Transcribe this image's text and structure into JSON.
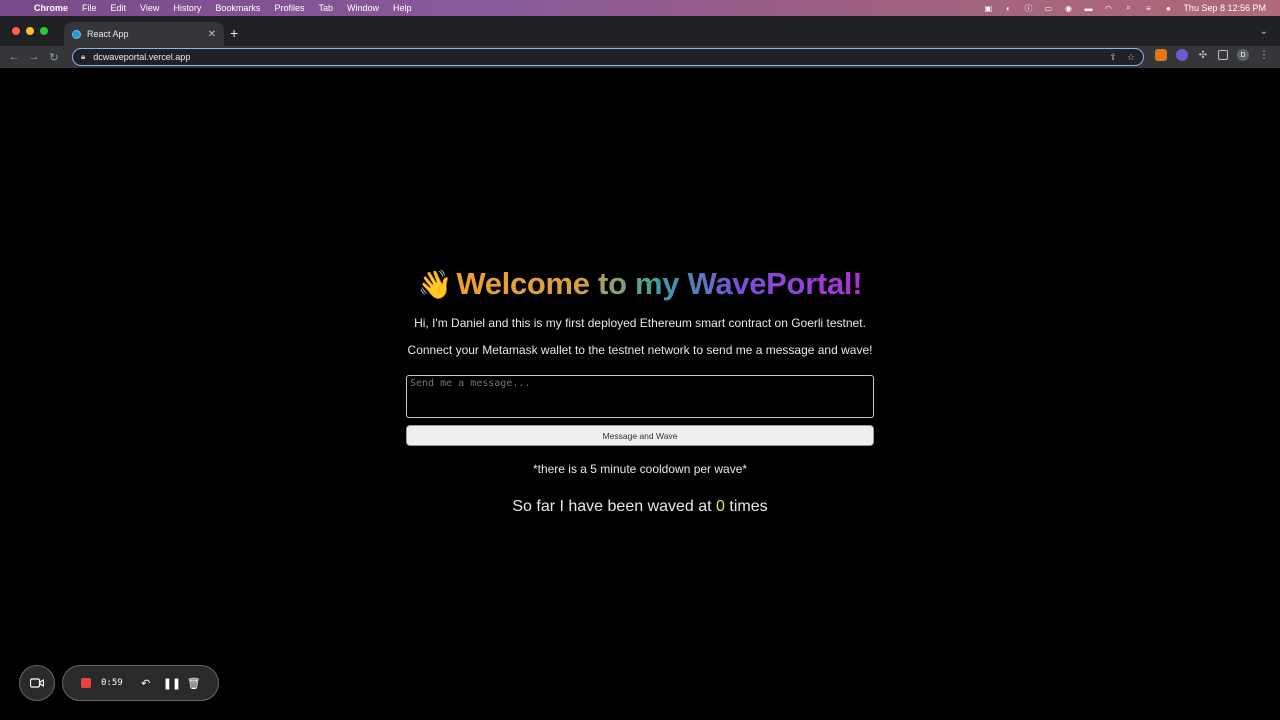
{
  "menubar": {
    "items": [
      "Chrome",
      "File",
      "Edit",
      "View",
      "History",
      "Bookmarks",
      "Profiles",
      "Tab",
      "Window",
      "Help"
    ],
    "clock": "Thu Sep 8  12:56 PM"
  },
  "browser": {
    "tab_title": "React App",
    "url": "dcwaveportal.vercel.app",
    "profile_initial": "D"
  },
  "page": {
    "title_emoji": "👋",
    "title": "Welcome to my WavePortal!",
    "intro": "Hi, I'm Daniel and this is my first deployed Ethereum smart contract on Goerli testnet.",
    "instructions": "Connect your Metamask wallet to the testnet network to send me a message and wave!",
    "message_placeholder": "Send me a message...",
    "message_value": "",
    "wave_button": "Message and Wave",
    "cooldown_note": "*there is a 5 minute cooldown per wave*",
    "count_prefix": "So far I have been waved at ",
    "wave_count": "0",
    "count_suffix": " times"
  },
  "recorder": {
    "elapsed": "0:59"
  },
  "colors": {
    "accent_blue": "#8ab4f8",
    "count_yellow": "#e6e64a",
    "record_red": "#e8453c"
  }
}
